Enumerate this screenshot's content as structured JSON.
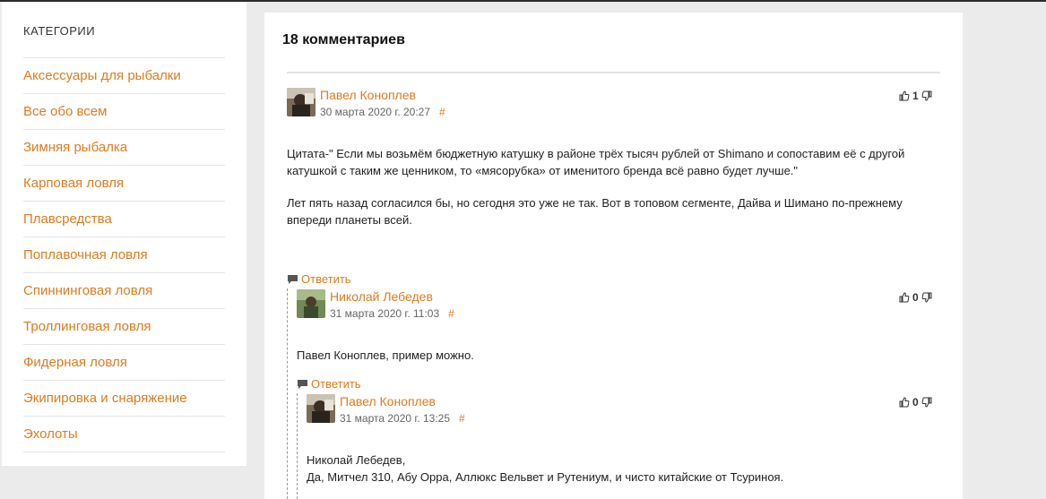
{
  "sidebar": {
    "title": "КАТЕГОРИИ",
    "items": [
      {
        "label": "Аксессуары для рыбалки"
      },
      {
        "label": "Все обо всем"
      },
      {
        "label": "Зимняя рыбалка"
      },
      {
        "label": "Карповая ловля"
      },
      {
        "label": "Плавсредства"
      },
      {
        "label": "Поплавочная ловля"
      },
      {
        "label": "Спиннинговая ловля"
      },
      {
        "label": "Троллинговая ловля"
      },
      {
        "label": "Фидерная ловля"
      },
      {
        "label": "Экипировка и снаряжение"
      },
      {
        "label": "Эхолоты"
      }
    ]
  },
  "comments": {
    "title": "18 комментариев",
    "reply_label": "Ответить",
    "hash": "#",
    "items": [
      {
        "author": "Павел Коноплев",
        "date": "30 марта 2020 г. 20:27",
        "votes": "1",
        "text_1": "Цитата-\" Если мы возьмём бюджетную катушку в районе трёх тысяч рублей от Shimano и сопоставим её с другой катушкой с таким же ценником, то «мясорубка» от именитого бренда всё равно будет лучше.\"",
        "text_2": "Лет пять назад согласился бы, но сегодня это уже не так. Вот в топовом сегменте, Дайва и Шимано по-прежнему впереди планеты всей."
      },
      {
        "author": "Николай Лебедев",
        "date": "31 марта 2020 г. 11:03",
        "votes": "0",
        "text_1": "Павел Коноплев, пример можно."
      },
      {
        "author": "Павел Коноплев",
        "date": "31 марта 2020 г. 13:25",
        "votes": "0",
        "text_1": "Николай Лебедев,",
        "text_2": "Да, Митчел 310, Абу Орра, Аллюкс Вельвет и Рутениум, и чисто китайские от Тсуриноя."
      }
    ]
  },
  "colors": {
    "accent": "#e07b1e",
    "background": "#ebebeb"
  }
}
